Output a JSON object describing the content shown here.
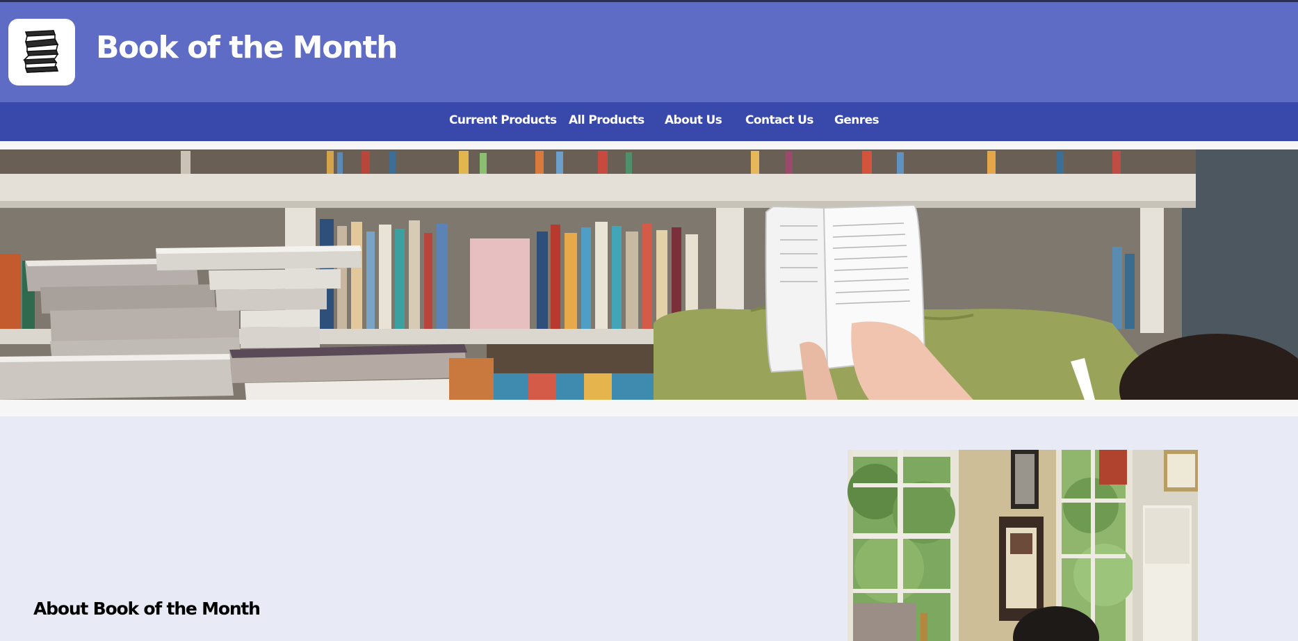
{
  "header": {
    "title": "Book of the Month",
    "logo_icon": "book-stack-icon",
    "background_color": "#5e6cc5"
  },
  "nav": {
    "background_color": "#3949ab",
    "items": [
      {
        "label": "Current Products"
      },
      {
        "label": "All Products"
      },
      {
        "label": "About Us"
      },
      {
        "label": "Contact Us"
      },
      {
        "label": "Genres"
      }
    ]
  },
  "hero": {
    "image": "person-reading-on-sofa-bookshelf-photo"
  },
  "about": {
    "heading": "About Book of the Month",
    "image": "person-reading-by-window-photo",
    "background_color": "#e8eaf5"
  }
}
